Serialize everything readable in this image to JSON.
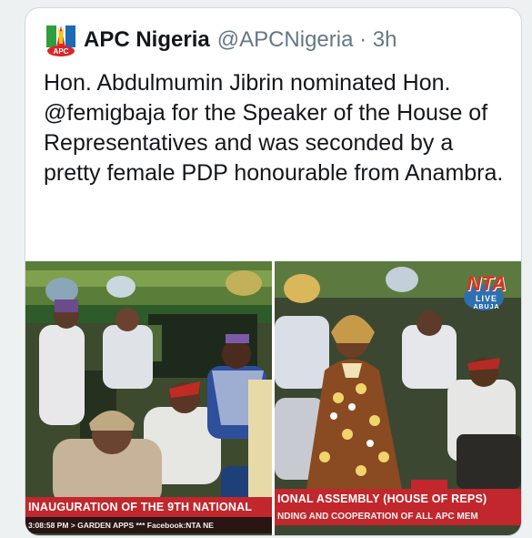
{
  "tweet": {
    "display_name": "APC Nigeria",
    "handle_time": "@APCNigeria · 3h",
    "logo_text": "APC",
    "text": "Hon. Abdulmumin Jibrin nominated Hon. @femigbaja for the Speaker of the House of Representatives and was seconded by a pretty female PDP honourable from Anambra."
  },
  "media": {
    "left_photo": {
      "ticker_main": "INAUGURATION OF THE 9TH NATIONAL",
      "ticker_sub": "3:08:58 PM  > GARDEN APPS *** Facebook:NTA NE"
    },
    "right_photo": {
      "ticker_main": "IONAL ASSEMBLY (HOUSE OF REPS)",
      "ticker_sub": "NDING AND COOPERATION OF ALL APC MEM",
      "badge_top": "NTA",
      "badge_mid": "LIVE",
      "badge_bottom": "ABUJA"
    }
  },
  "colors": {
    "ticker_red": "#c1272d",
    "ticker_dark": "#2a1414",
    "handle_grey": "#657786",
    "text_dark": "#14171a"
  }
}
